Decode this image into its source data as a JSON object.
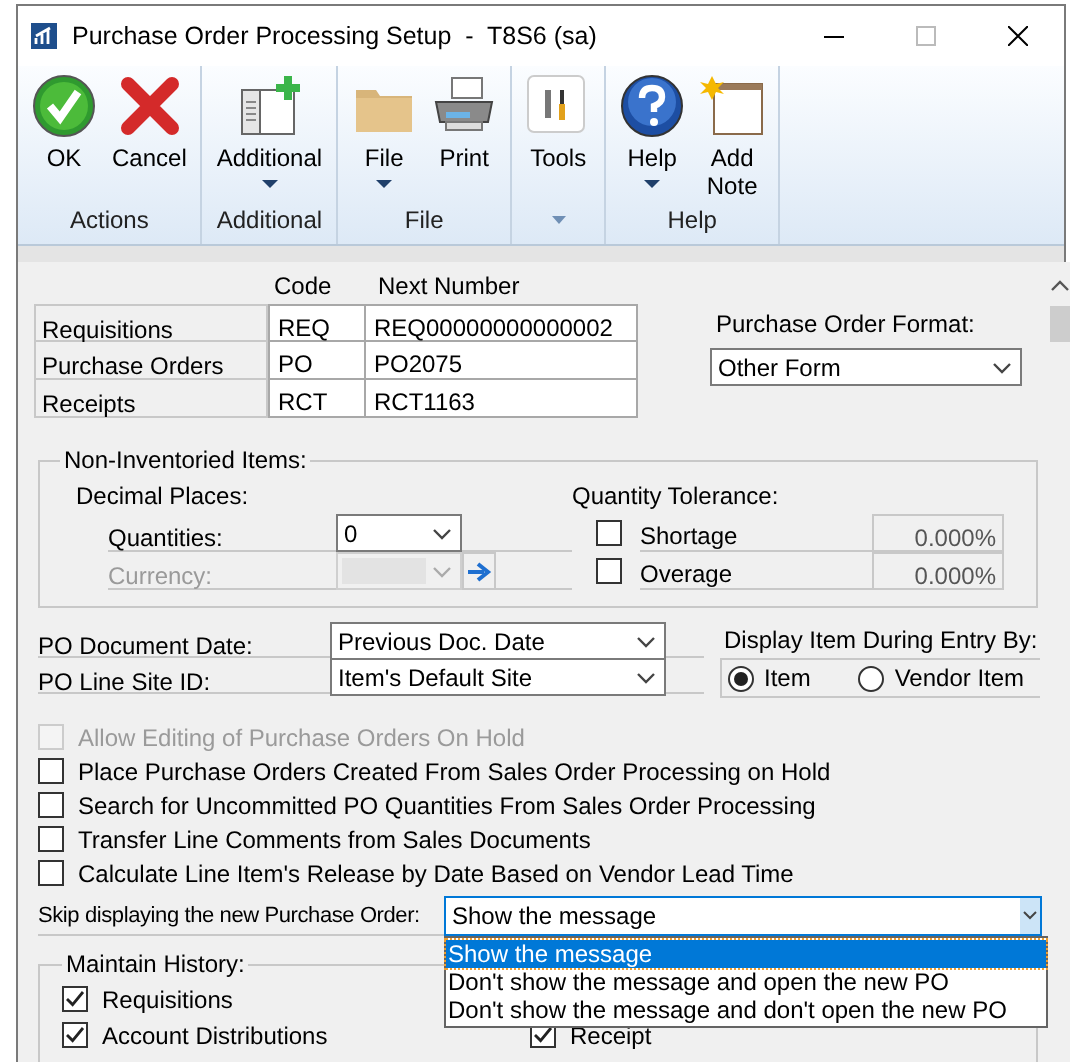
{
  "window": {
    "title": "Purchase Order Processing Setup  -  T8S6 (sa)"
  },
  "ribbon": {
    "groups": [
      {
        "label": "Actions",
        "buttons": [
          {
            "label": "OK",
            "kind": "ok",
            "dropdown": false
          },
          {
            "label": "Cancel",
            "kind": "cancel",
            "dropdown": false
          }
        ]
      },
      {
        "label": "Additional",
        "buttons": [
          {
            "label": "Additional",
            "kind": "additional",
            "dropdown": true
          }
        ]
      },
      {
        "label": "File",
        "buttons": [
          {
            "label": "File",
            "kind": "folder",
            "dropdown": true
          },
          {
            "label": "Print",
            "kind": "printer",
            "dropdown": false
          }
        ]
      },
      {
        "buttons": [
          {
            "label": "Tools",
            "kind": "tools",
            "dropdown": false
          }
        ]
      },
      {
        "label": "Help",
        "buttons": [
          {
            "label": "Help",
            "kind": "help",
            "dropdown": true
          },
          {
            "label": "Add Note",
            "kind": "note",
            "dropdown": false
          }
        ]
      }
    ]
  },
  "numbering": {
    "columns": [
      "Code",
      "Next Number"
    ],
    "rows": [
      {
        "label": "Requisitions",
        "code": "REQ",
        "next_number": "REQ00000000000002"
      },
      {
        "label": "Purchase Orders",
        "code": "PO",
        "next_number": "PO2075"
      },
      {
        "label": "Receipts",
        "code": "RCT",
        "next_number": "RCT1163"
      }
    ]
  },
  "po_format": {
    "label": "Purchase Order Format:",
    "value": "Other Form"
  },
  "non_inventoried": {
    "title": "Non-Inventoried Items:",
    "decimal_places": {
      "label": "Decimal Places:",
      "fields": [
        {
          "label": "Quantities:",
          "value": "0",
          "disabled": false
        },
        {
          "label": "Currency:",
          "disabled": true
        }
      ]
    },
    "tolerance": {
      "label": "Quantity Tolerance:",
      "items": [
        {
          "label": "Shortage",
          "checked": false,
          "value": "0.000%"
        },
        {
          "label": "Overage",
          "checked": false,
          "value": "0.000%"
        }
      ]
    }
  },
  "po_fields": [
    {
      "label": "PO Document Date:",
      "value": "Previous Doc. Date"
    },
    {
      "label": "PO Line Site ID:",
      "value": "Item's Default Site"
    }
  ],
  "display_item": {
    "label": "Display Item During Entry By:",
    "options": [
      {
        "label": "Item",
        "selected": true
      },
      {
        "label": "Vendor Item",
        "selected": false
      }
    ]
  },
  "options": [
    {
      "label": "Allow Editing of Purchase Orders On Hold",
      "checked": false,
      "disabled": true
    },
    {
      "label": "Place Purchase Orders Created From Sales Order Processing on Hold",
      "checked": false,
      "disabled": false
    },
    {
      "label": "Search for Uncommitted PO Quantities From Sales Order Processing",
      "checked": false,
      "disabled": false
    },
    {
      "label": "Transfer Line Comments from Sales Documents",
      "checked": false,
      "disabled": false
    },
    {
      "label": "Calculate Line Item's Release by Date Based on Vendor Lead Time",
      "checked": false,
      "disabled": false
    }
  ],
  "skip": {
    "label": "Skip displaying the new Purchase Order:",
    "value": "Show the message",
    "expanded": true,
    "options": [
      {
        "label": "Show the message",
        "selected": true
      },
      {
        "label": "Don't show the message and open the new PO",
        "selected": false
      },
      {
        "label": "Don't show the message and don't open the new PO",
        "selected": false
      }
    ]
  },
  "maintain_history": {
    "title": "Maintain History:",
    "left": [
      {
        "label": "Requisitions",
        "checked": true
      },
      {
        "label": "Account Distributions",
        "checked": true
      }
    ],
    "right": [
      {
        "label": "Receipt",
        "checked": true
      }
    ]
  }
}
